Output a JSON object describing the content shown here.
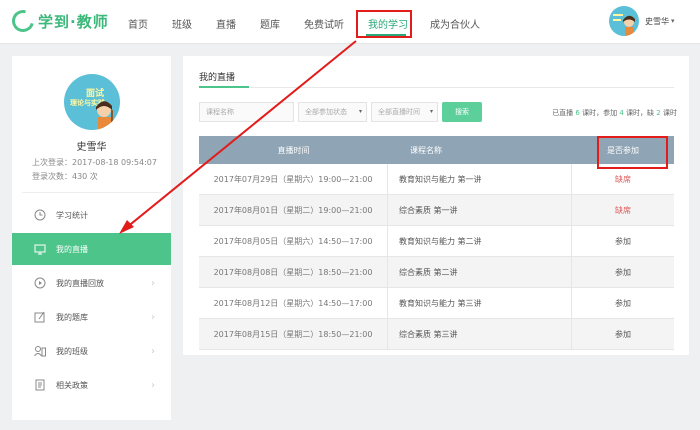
{
  "header": {
    "logo_text": "学到·教师",
    "nav": [
      {
        "label": "首页"
      },
      {
        "label": "班级"
      },
      {
        "label": "直播"
      },
      {
        "label": "题库"
      },
      {
        "label": "免费试听"
      },
      {
        "label": "我的学习",
        "active": true
      },
      {
        "label": "成为合伙人"
      }
    ],
    "user_name": "史雪华",
    "accent_color": "#2aa87a"
  },
  "sidebar": {
    "avatar_text": [
      "面试",
      "理论与实践"
    ],
    "name": "史雪华",
    "last_login": "上次登录：2017-08-18 09:54:07",
    "login_count": "登录次数：430 次",
    "menu": [
      {
        "label": "学习统计",
        "icon": "clock-icon"
      },
      {
        "label": "我的直播",
        "icon": "monitor-icon",
        "active": true
      },
      {
        "label": "我的直播回放",
        "icon": "play-circle-icon"
      },
      {
        "label": "我的题库",
        "icon": "edit-icon"
      },
      {
        "label": "我的班级",
        "icon": "users-icon"
      },
      {
        "label": "相关政策",
        "icon": "document-icon"
      }
    ]
  },
  "main": {
    "title": "我的直播",
    "filters": {
      "course_placeholder": "课程名称",
      "status_select": "全部参加状态",
      "time_select": "全部直播时间",
      "search_label": "搜索"
    },
    "stats": {
      "prefix": "已直播",
      "total": "6",
      "mid1": "课时，参加",
      "attended": "4",
      "mid2": "课时，缺",
      "absent": "2",
      "suffix": "课时"
    },
    "table": {
      "headers": [
        "直播时间",
        "课程名称",
        "是否参加"
      ],
      "rows": [
        {
          "time": "2017年07月29日（星期六）19:00—21:00",
          "course": "教育知识与能力 第一讲",
          "status": "缺席",
          "absent": true
        },
        {
          "time": "2017年08月01日（星期二）19:00—21:00",
          "course": "综合素质 第一讲",
          "status": "缺席",
          "absent": true
        },
        {
          "time": "2017年08月05日（星期六）14:50—17:00",
          "course": "教育知识与能力 第二讲",
          "status": "参加",
          "absent": false
        },
        {
          "time": "2017年08月08日（星期二）18:50—21:00",
          "course": "综合素质 第二讲",
          "status": "参加",
          "absent": false
        },
        {
          "time": "2017年08月12日（星期六）14:50—17:00",
          "course": "教育知识与能力 第三讲",
          "status": "参加",
          "absent": false
        },
        {
          "time": "2017年08月15日（星期二）18:50—21:00",
          "course": "综合素质 第三讲",
          "status": "参加",
          "absent": false
        }
      ]
    }
  }
}
